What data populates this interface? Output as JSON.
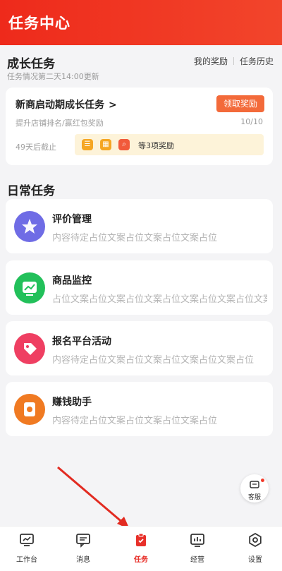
{
  "header": {
    "title": "任务中心"
  },
  "growth_section": {
    "title": "成长任务",
    "subtitle": "任务情况第二天14:00更新",
    "links": [
      "我的奖励",
      "任务历史"
    ],
    "card": {
      "title": "新商启动期成长任务",
      "chevron": ">",
      "claim_label": "领取奖励",
      "desc": "提升店铺排名/赢红包奖励",
      "progress": "10/10",
      "deadline": "49天后截止",
      "reward_text": "等3项奖励"
    }
  },
  "daily_section": {
    "title": "日常任务",
    "tasks": [
      {
        "title": "评价管理",
        "desc": "内容待定占位文案占位文案占位文案占位",
        "color": "#6f6ce5"
      },
      {
        "title": "商品监控",
        "desc": "占位文案占位文案占位文案占位文案占位文案占位文案",
        "color": "#22c05a"
      },
      {
        "title": "报名平台活动",
        "desc": "内容待定占位文案占位文案占位文案占位文案占位",
        "color": "#ef3f62"
      },
      {
        "title": "赚钱助手",
        "desc": "内容待定占位文案占位文案占位文案占位",
        "color": "#f07a22"
      }
    ]
  },
  "service": {
    "label": "客服"
  },
  "tabbar": {
    "items": [
      {
        "label": "工作台",
        "icon": "monitor-icon"
      },
      {
        "label": "消息",
        "icon": "message-icon"
      },
      {
        "label": "任务",
        "icon": "clipboard-icon",
        "active": true
      },
      {
        "label": "经营",
        "icon": "chart-icon"
      },
      {
        "label": "设置",
        "icon": "gear-icon"
      }
    ],
    "active_color": "#e8302a"
  }
}
